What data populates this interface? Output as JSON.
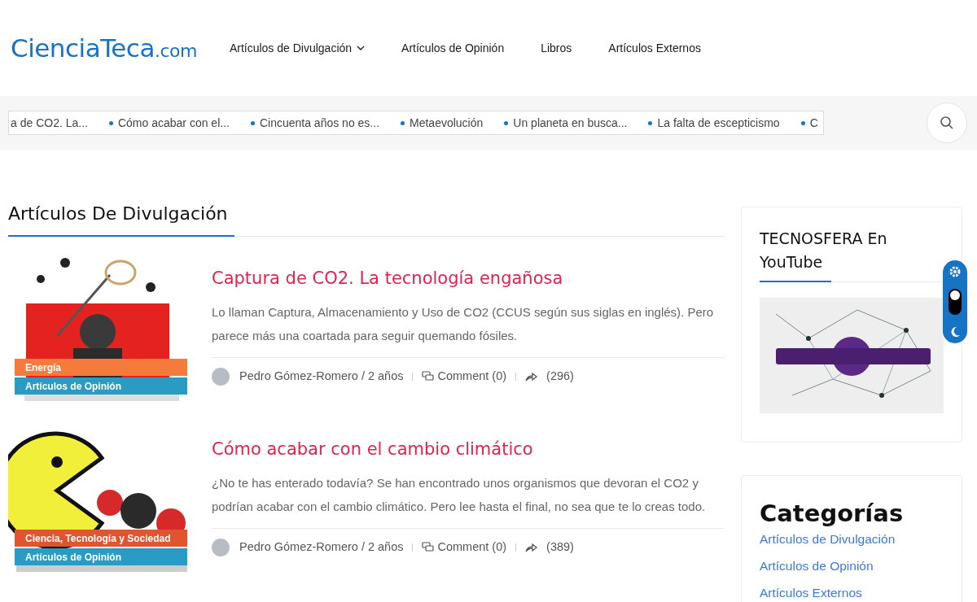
{
  "logo": {
    "main": "CienciaTeca",
    "suffix": ".com"
  },
  "nav": [
    {
      "label": "Artículos de Divulgación",
      "dropdown": true
    },
    {
      "label": "Artículos de Opinión",
      "dropdown": false
    },
    {
      "label": "Libros",
      "dropdown": false
    },
    {
      "label": "Artículos Externos",
      "dropdown": false
    }
  ],
  "ticker": [
    {
      "text": "a de CO2. La...",
      "kind": "cut"
    },
    {
      "text": "Cómo acabar con el...",
      "kind": "full"
    },
    {
      "text": "Cincuenta años no es...",
      "kind": "full"
    },
    {
      "text": "Metaevolución",
      "kind": "full"
    },
    {
      "text": "Un planeta en busca...",
      "kind": "full"
    },
    {
      "text": "La falta de escepticismo",
      "kind": "full"
    },
    {
      "text": "C",
      "kind": "full"
    }
  ],
  "section_title": "Artículos De Divulgación",
  "posts": [
    {
      "title": "Captura de CO2. La tecnología engañosa",
      "excerpt": "Lo llaman Captura, Almacenamiento y Uso de CO2 (CCUS según sus siglas en inglés). Pero parece más una coartada para seguir quemando fósiles.",
      "tags": [
        {
          "label": "Energía",
          "color": "#f47b3c"
        },
        {
          "label": "Artículos de Opinión",
          "color": "#2a9cc4"
        }
      ],
      "author": "Pedro Gómez-Romero / 2 años",
      "comments": "Comment (0)",
      "shares": "(296)"
    },
    {
      "title": "Cómo acabar con el cambio climático",
      "excerpt": "¿No te has enterado todavía? Se han encontrado unos organismos que devoran el CO2 y podrían acabar con el cambio climático. Pero lee hasta el final, no sea que te lo creas todo.",
      "tags": [
        {
          "label": "Ciencia, Tecnología y Sociedad",
          "color": "#e0552e"
        },
        {
          "label": "Artículos de Opinión",
          "color": "#2a9cc4"
        }
      ],
      "author": "Pedro Gómez-Romero / 2 años",
      "comments": "Comment (0)",
      "shares": "(389)"
    }
  ],
  "sidebar": {
    "video_widget": {
      "title": "TECNOSFERA En YouTube"
    },
    "categories": {
      "title": "Categorías",
      "items": [
        "Artículos de Divulgación",
        "Artículos de Opinión",
        "Artículos Externos"
      ]
    }
  },
  "theme_switch": {
    "dark": false
  }
}
